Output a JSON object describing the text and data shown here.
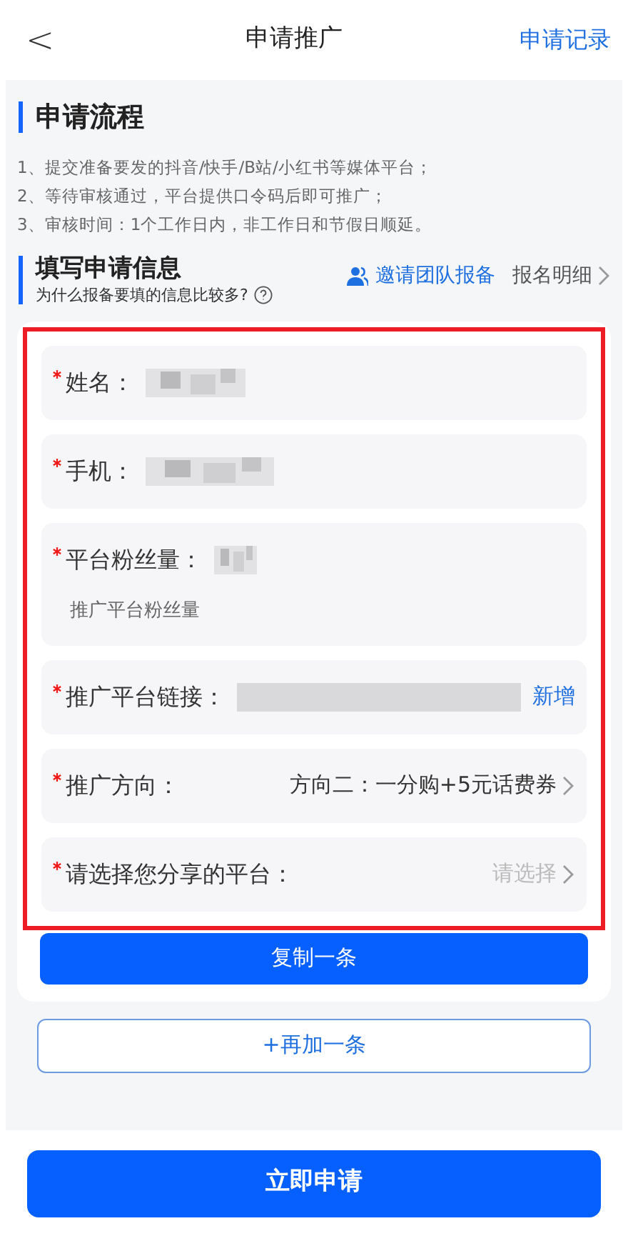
{
  "header": {
    "back": "<",
    "title": "申请推广",
    "action": "申请记录"
  },
  "process": {
    "title": "申请流程",
    "steps": [
      "1、提交准备要发的抖音/快手/B站/小红书等媒体平台；",
      "2、等待审核通过，平台提供口令码后即可推广；",
      "3、审核时间：1个工作日内，非工作日和节假日顺延。"
    ]
  },
  "form_section": {
    "title": "填写申请信息",
    "subtitle": "为什么报备要填的信息比较多?",
    "invite": "邀请团队报备",
    "details": "报名明细"
  },
  "fields": [
    {
      "kind": "input",
      "required": true,
      "label": "姓名："
    },
    {
      "kind": "input",
      "required": true,
      "label": "手机："
    },
    {
      "kind": "input",
      "required": true,
      "label": "平台粉丝量：",
      "note": "推广平台粉丝量"
    },
    {
      "kind": "link",
      "required": true,
      "label": "推广平台链接：",
      "action": "新增"
    },
    {
      "kind": "select",
      "required": true,
      "label": "推广方向：",
      "value": "方向二：一分购+5元话费券"
    },
    {
      "kind": "select",
      "required": true,
      "label": "请选择您分享的平台：",
      "placeholder": "请选择"
    }
  ],
  "copy_button": "复制一条",
  "add_button": "+再加一条",
  "submit_button": "立即申请"
}
